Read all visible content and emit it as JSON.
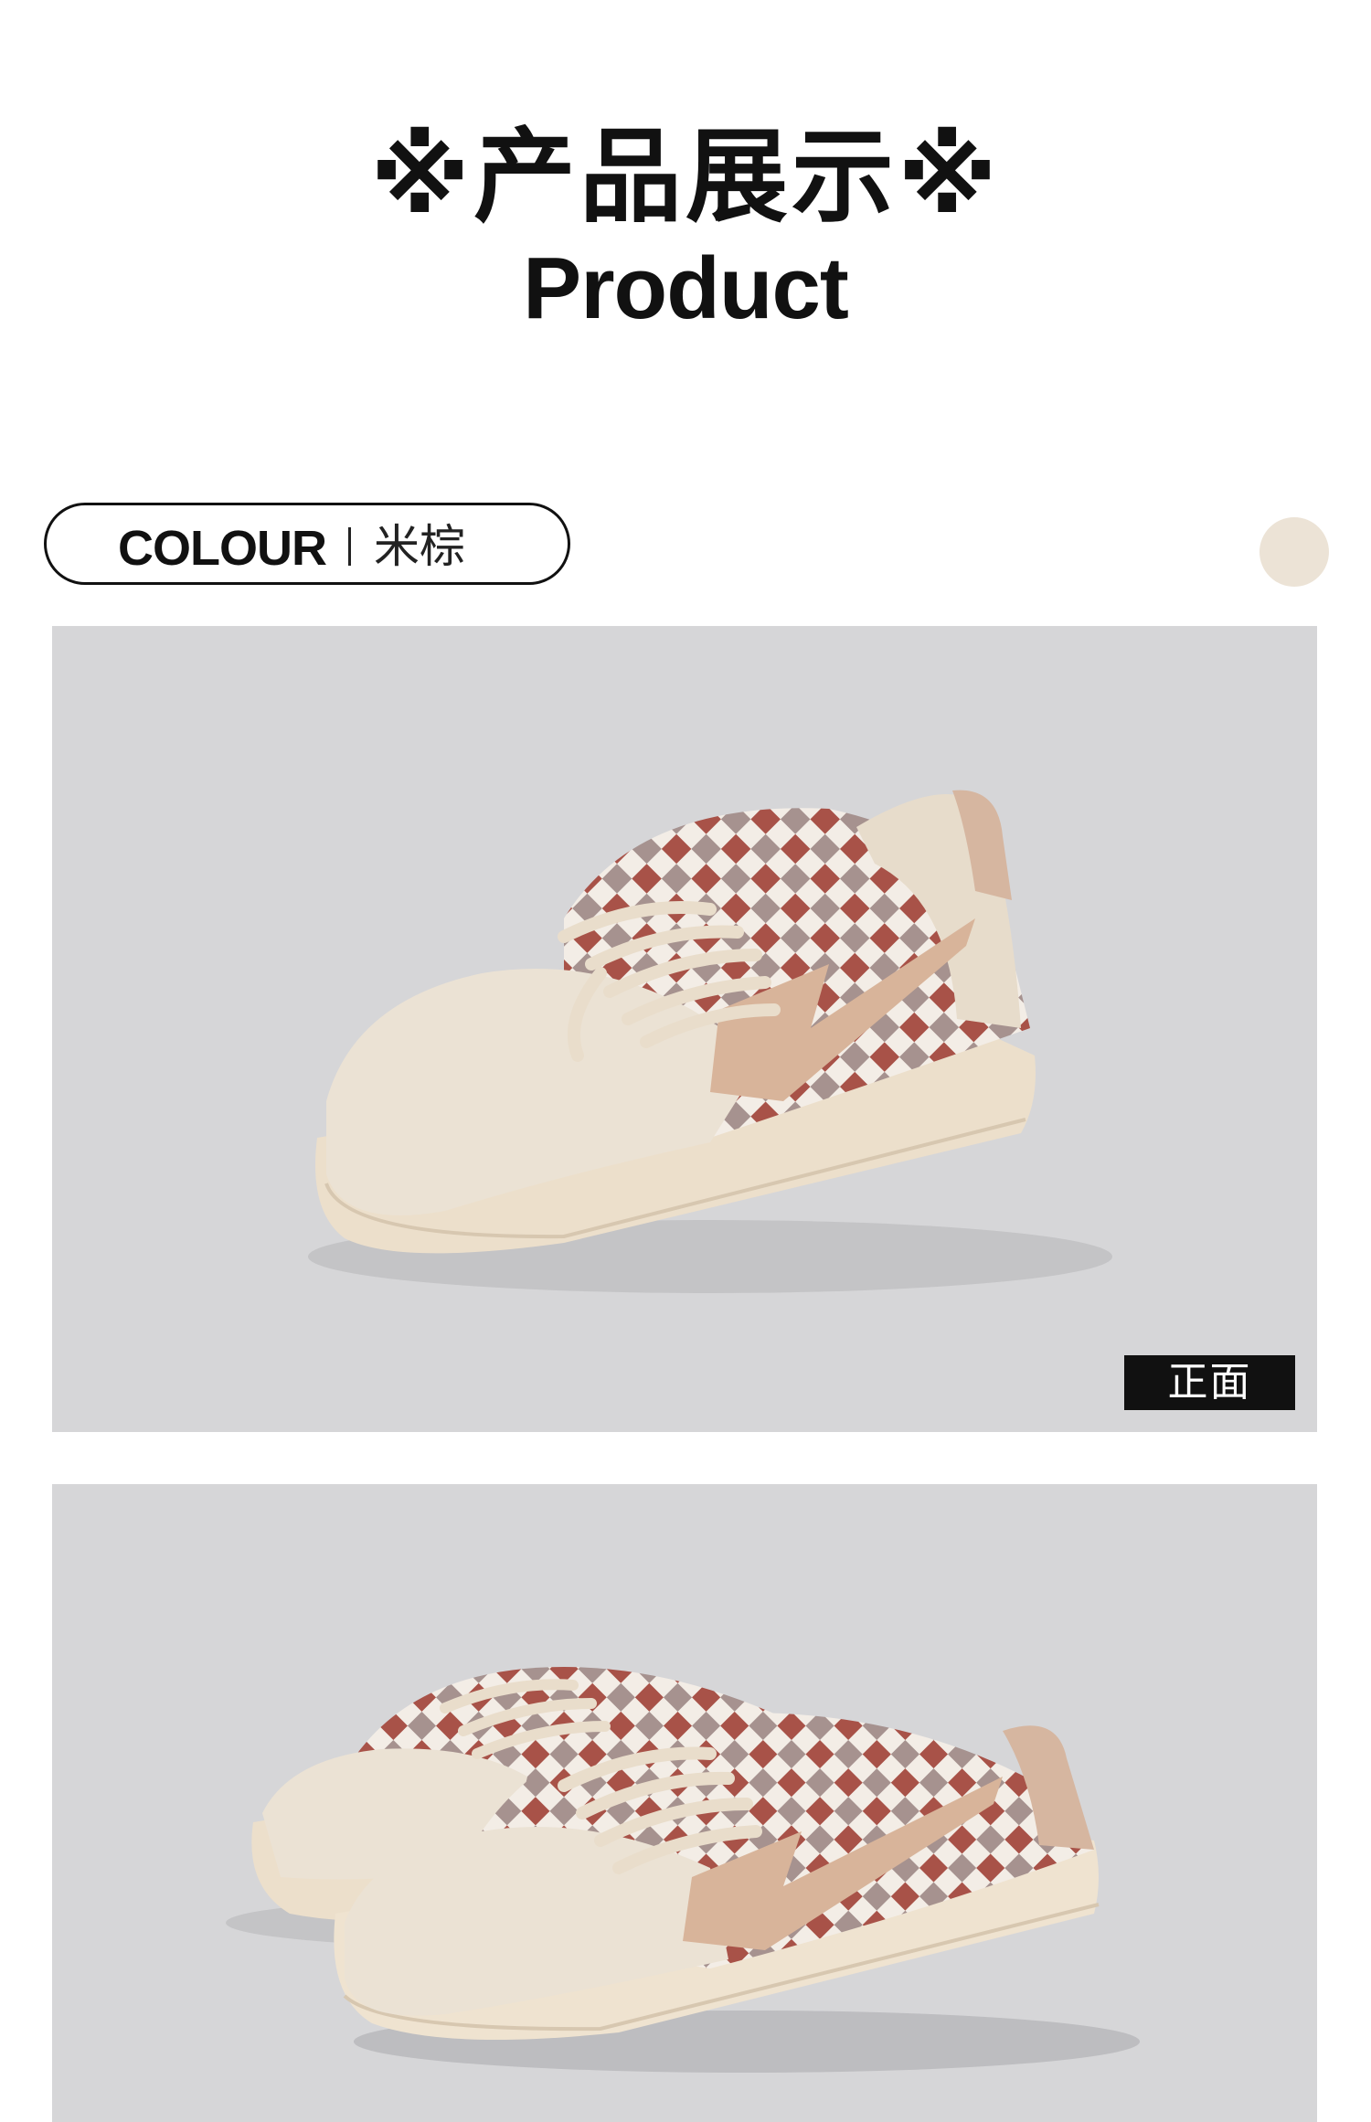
{
  "header": {
    "title_cn": "※产品展示※",
    "title_en": "Product"
  },
  "colour": {
    "label": "COLOUR",
    "name": "米棕",
    "swatch_color": "#ece3d6"
  },
  "photos": [
    {
      "view_label": "正面"
    },
    {
      "view_label": ""
    }
  ]
}
